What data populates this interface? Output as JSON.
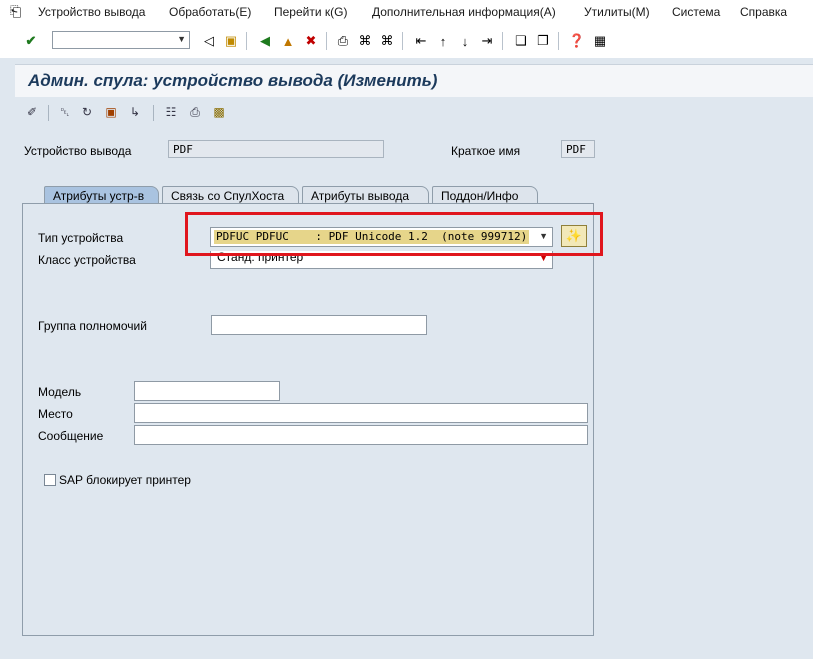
{
  "menubar": {
    "items": [
      {
        "label": "Устройство вывода"
      },
      {
        "label": "Обработать(E)"
      },
      {
        "label": "Перейти к(G)"
      },
      {
        "label": "Дополнительная информация(A)"
      },
      {
        "label": "Утилиты(M)"
      },
      {
        "label": "Система"
      },
      {
        "label": "Справка"
      }
    ]
  },
  "toolbar": {
    "command_field_value": ""
  },
  "page": {
    "title": "Админ. спула: устройство вывода (Изменить)"
  },
  "header": {
    "device_label": "Устройство вывода",
    "device_value": "PDF",
    "shortname_label": "Краткое имя",
    "shortname_value": "PDF"
  },
  "tabs": [
    {
      "label": "Атрибуты устр-в",
      "active": true
    },
    {
      "label": "Связь со СпулХоста",
      "active": false
    },
    {
      "label": "Атрибуты вывода",
      "active": false
    },
    {
      "label": "Поддон/Инфо",
      "active": false
    }
  ],
  "form": {
    "device_type_label": "Тип устройства",
    "device_type_value": "PDFUC PDFUC    : PDF Unicode 1.2  (note 999712)",
    "device_class_label": "Класс устройства",
    "device_class_value": "Станд. принтер",
    "auth_group_label": "Группа полномочий",
    "auth_group_value": "",
    "model_label": "Модель",
    "model_value": "",
    "location_label": "Место",
    "location_value": "",
    "message_label": "Сообщение",
    "message_value": "",
    "sap_lock_label": "SAP блокирует принтер",
    "sap_lock_checked": false
  },
  "colors": {
    "highlight": "#e0161d",
    "title_text": "#1c3a5c",
    "background": "#dfe7ef",
    "active_tab": "#a9c3e0"
  }
}
